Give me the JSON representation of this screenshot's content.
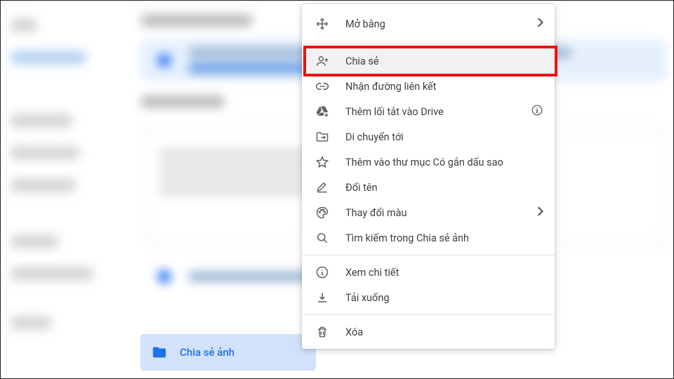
{
  "folder_chip": {
    "label": "Chia sẻ ảnh"
  },
  "menu": {
    "open": "Mở bằng",
    "share": "Chia sẻ",
    "get_link": "Nhận đường liên kết",
    "add_shortcut": "Thêm lối tắt vào Drive",
    "move_to": "Di chuyển tới",
    "star": "Thêm vào thư mục Có gắn dấu sao",
    "rename": "Đổi tên",
    "color": "Thay đổi màu",
    "search_in": "Tìm kiếm trong Chia sẻ ảnh",
    "details": "Xem chi tiết",
    "download": "Tải xuống",
    "remove": "Xóa"
  }
}
